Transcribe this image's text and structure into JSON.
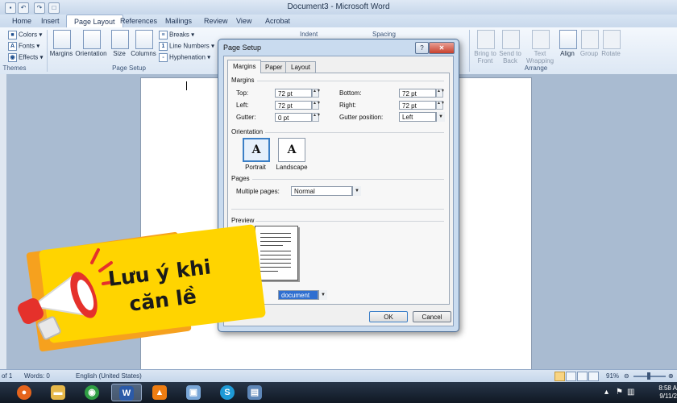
{
  "window": {
    "title": "Document3 - Microsoft Word"
  },
  "tabs": [
    "Home",
    "Insert",
    "Page Layout",
    "References",
    "Mailings",
    "Review",
    "View",
    "Acrobat"
  ],
  "ribbon": {
    "themes": {
      "colors": "Colors",
      "fonts": "Fonts",
      "effects": "Effects",
      "group": "Themes"
    },
    "page_setup": {
      "margins": "Margins",
      "orientation": "Orientation",
      "size": "Size",
      "columns": "Columns",
      "breaks": "Breaks",
      "line_numbers": "Line Numbers",
      "hyphenation": "Hyphenation",
      "group": "Page Setup"
    },
    "indent": "Indent",
    "spacing": "Spacing",
    "arrange": {
      "bring_to_front": "Bring to Front",
      "send_to_back": "Send to Back",
      "text_wrapping": "Text Wrapping",
      "align": "Align",
      "group_btn": "Group",
      "rotate": "Rotate",
      "group": "Arrange"
    }
  },
  "dialog": {
    "title": "Page Setup",
    "help": "?",
    "tabs": [
      "Margins",
      "Paper",
      "Layout"
    ],
    "margins_section": "Margins",
    "top_label": "Top:",
    "top_value": "72 pt",
    "bottom_label": "Bottom:",
    "bottom_value": "72 pt",
    "left_label": "Left:",
    "left_value": "72 pt",
    "right_label": "Right:",
    "right_value": "72 pt",
    "gutter_label": "Gutter:",
    "gutter_value": "0 pt",
    "gutter_pos_label": "Gutter position:",
    "gutter_pos_value": "Left",
    "orientation_section": "Orientation",
    "portrait": "Portrait",
    "landscape": "Landscape",
    "pages_section": "Pages",
    "multiple_pages_label": "Multiple pages:",
    "multiple_pages_value": "Normal",
    "preview_section": "Preview",
    "apply_to_value": "document",
    "ok": "OK",
    "cancel": "Cancel"
  },
  "banner": {
    "line1": "Lưu ý khi",
    "line2": "căn lề"
  },
  "statusbar": {
    "page": "of 1",
    "words": "Words: 0",
    "language": "English (United States)",
    "zoom": "91%"
  },
  "taskbar": {
    "time": "8:58 A",
    "date": "9/11/2"
  }
}
